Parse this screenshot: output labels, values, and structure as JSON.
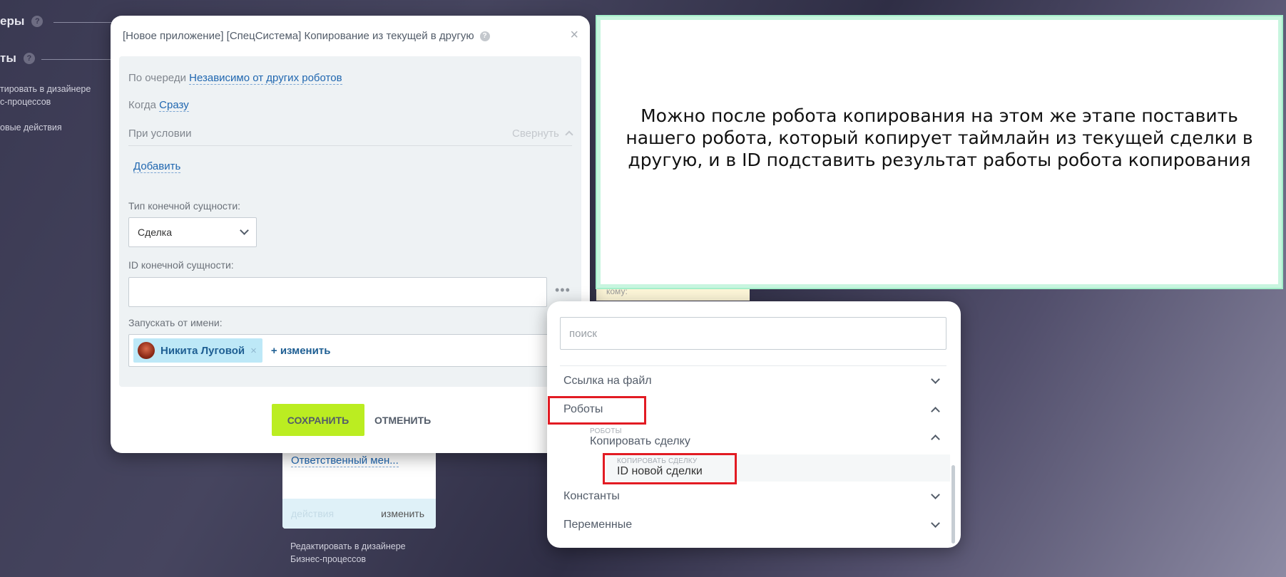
{
  "background": {
    "heading_1": "еры",
    "heading_2": "ты",
    "help_glyph": "?",
    "left_link_line1": "тировать в дизайнере",
    "left_link_line2": "с-процессов",
    "left_link_2": "овые действия",
    "card_link": "Ответственный мен...",
    "card_actions": "действия",
    "card_change": "изменить",
    "card_bottom_line1": "Редактировать в дизайнере",
    "card_bottom_line2": "Бизнес-процессов",
    "yellow_text": "кому:"
  },
  "dialog": {
    "title": "[Новое приложение] [СпецСистема] Копирование из текущей в другую",
    "help_glyph": "?",
    "close_glyph": "×",
    "queue_label": "По очереди",
    "queue_value": "Независимо от других роботов",
    "when_label": "Когда",
    "when_value": "Сразу",
    "condition_label": "При условии",
    "collapse_label": "Свернуть",
    "add_label": "Добавить",
    "entity_type_label": "Тип конечной сущности:",
    "entity_type_value": "Сделка",
    "entity_id_label": "ID конечной сущности:",
    "entity_id_value": "",
    "dots_glyph": "•••",
    "run_as_label": "Запускать от имени:",
    "user_name": "Никита Луговой",
    "remove_glyph": "×",
    "change_label": "+ изменить",
    "save_label": "СОХРАНИТЬ",
    "cancel_label": "ОТМЕНИТЬ"
  },
  "dropdown": {
    "search_placeholder": "поиск",
    "items": [
      {
        "label": "Ссылка на файл",
        "expanded": false
      },
      {
        "label": "Роботы",
        "expanded": true
      },
      {
        "label": "Константы",
        "expanded": false
      },
      {
        "label": "Переменные",
        "expanded": false
      }
    ],
    "robot_caption": "РОБОТЫ",
    "robot_name": "Копировать сделку",
    "leaf_caption": "КОПИРОВАТЬ СДЕЛКУ",
    "leaf_name": "ID новой сделки"
  },
  "note": {
    "text": "Можно после робота копирования на этом же этапе поставить нашего робота, который копирует таймлайн из текущей сделки в другую, и в ID подставить результат работы робота копирования"
  },
  "colors": {
    "accent_green": "#bbed21",
    "link_blue": "#2067b0",
    "highlight_red": "#e21b23",
    "note_border": "#a4efca"
  }
}
